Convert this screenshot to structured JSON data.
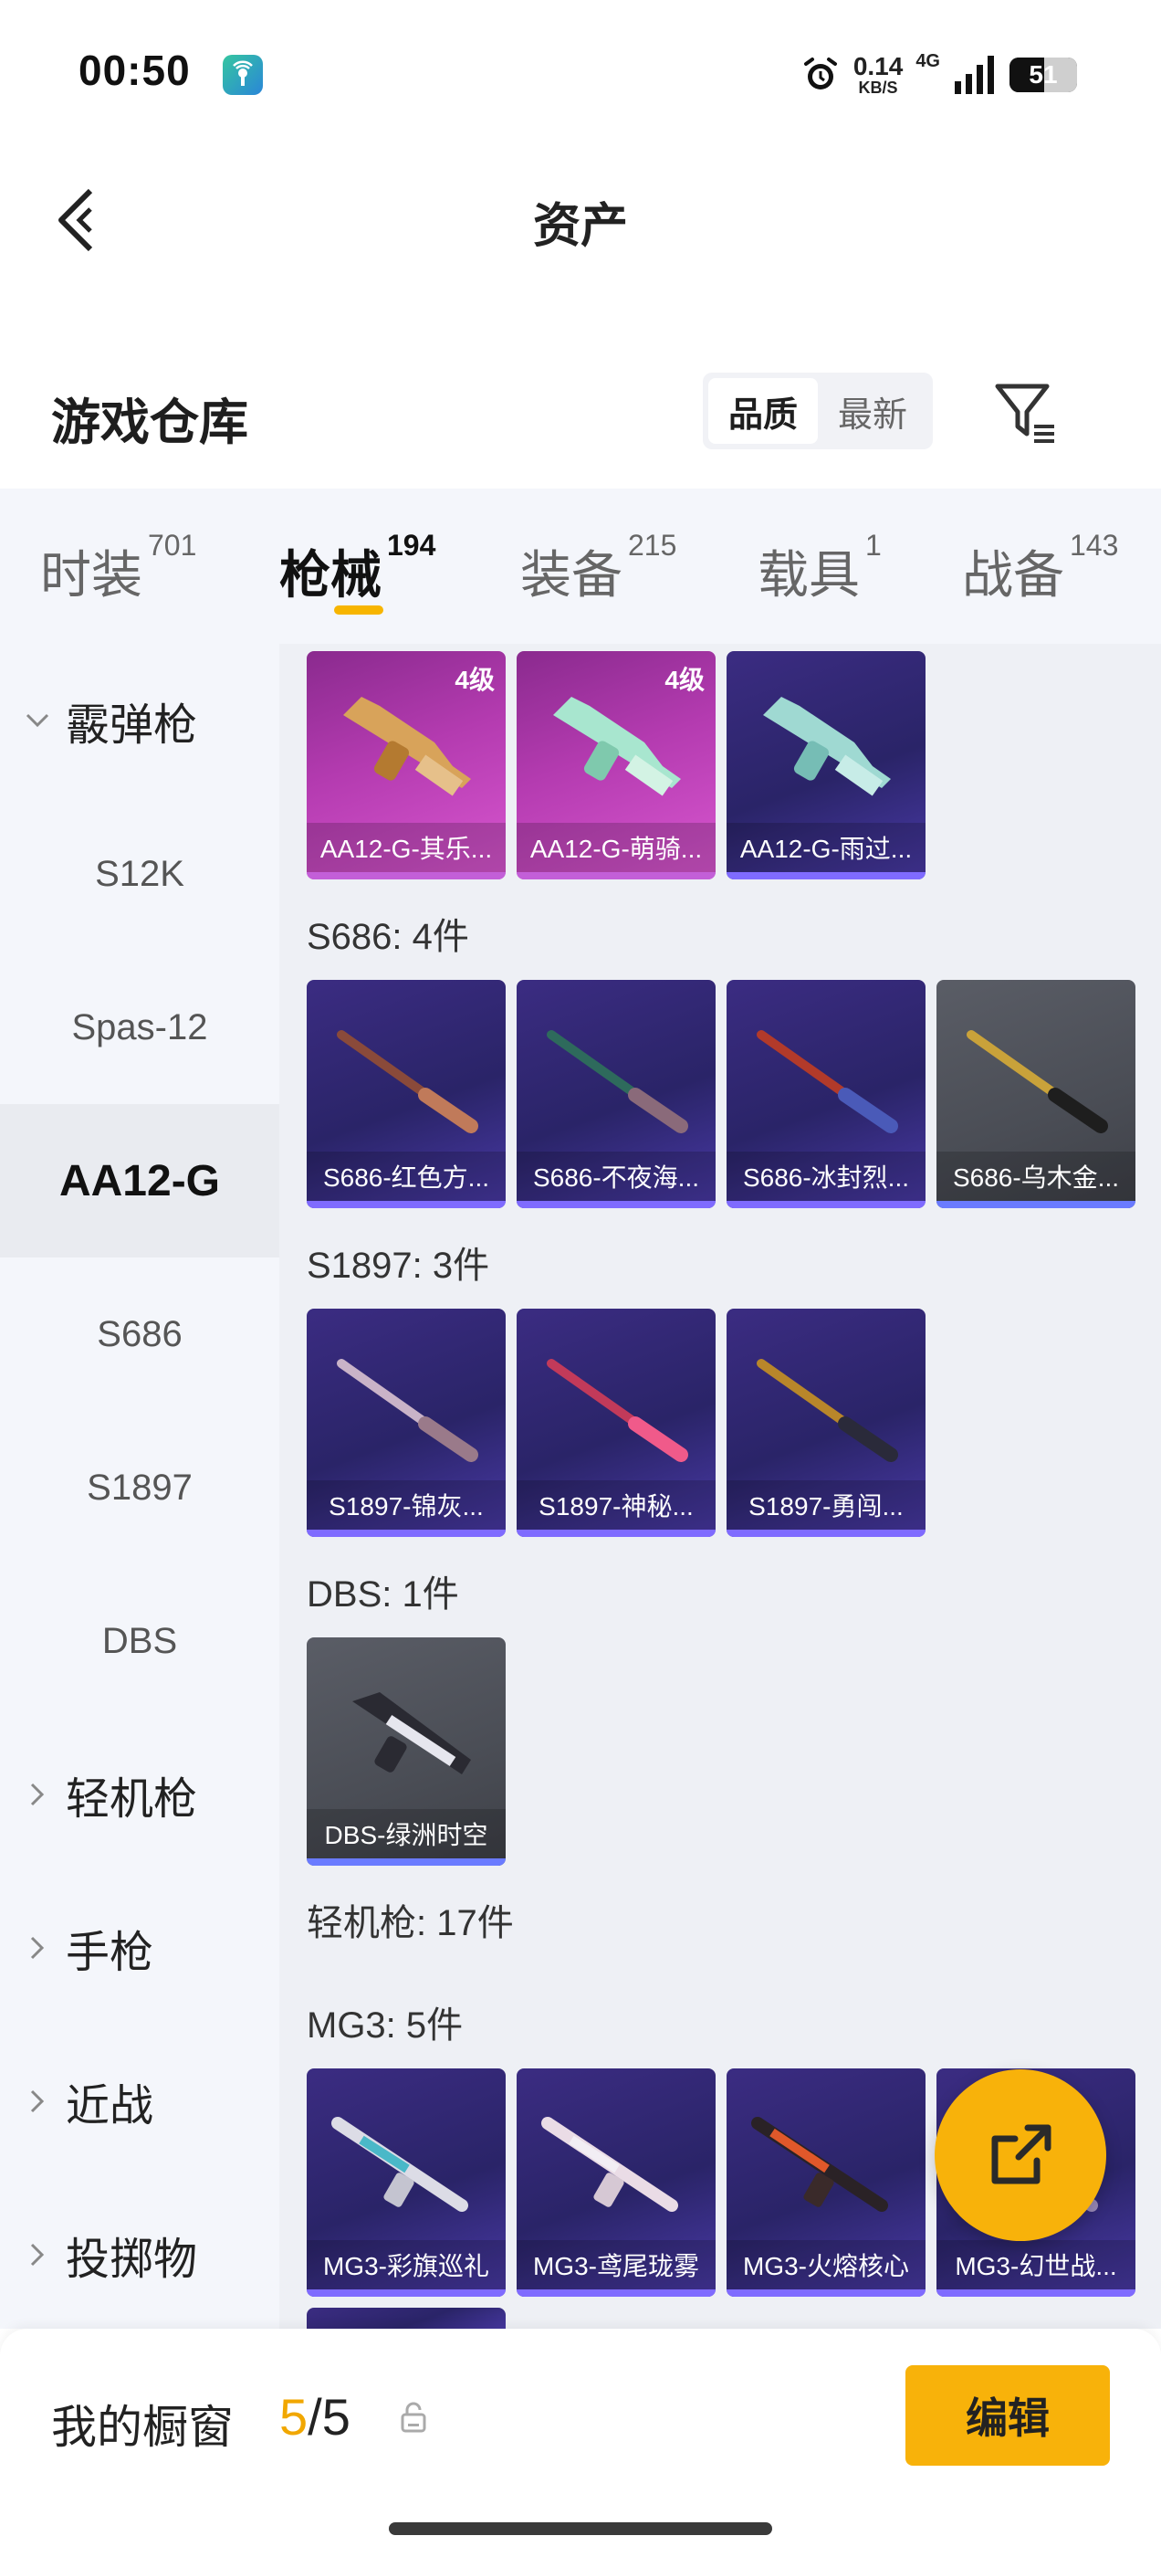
{
  "status_bar": {
    "time": "00:50",
    "net_speed": "0.14",
    "net_unit": "KB/S",
    "net_type": "4G",
    "battery": "51"
  },
  "header": {
    "title": "资产"
  },
  "warehouse": {
    "title": "游戏仓库",
    "sort_options": [
      "品质",
      "最新"
    ],
    "sort_active": "品质"
  },
  "tabs": [
    {
      "label": "时装",
      "count": "701"
    },
    {
      "label": "枪械",
      "count": "194"
    },
    {
      "label": "装备",
      "count": "215"
    },
    {
      "label": "载具",
      "count": "1"
    },
    {
      "label": "战备",
      "count": "143"
    }
  ],
  "sidebar": {
    "items": [
      {
        "label": "霰弹枪",
        "kind": "group-open"
      },
      {
        "label": "S12K"
      },
      {
        "label": "Spas-12"
      },
      {
        "label": "AA12-G",
        "active": true
      },
      {
        "label": "S686"
      },
      {
        "label": "S1897"
      },
      {
        "label": "DBS"
      },
      {
        "label": "轻机枪",
        "kind": "group"
      },
      {
        "label": "手枪",
        "kind": "group"
      },
      {
        "label": "近战",
        "kind": "group"
      },
      {
        "label": "投掷物",
        "kind": "group"
      }
    ]
  },
  "content": {
    "aa12_cards": [
      {
        "name": "AA12-G-其乐...",
        "level": "4级",
        "tier": "pink"
      },
      {
        "name": "AA12-G-萌骑...",
        "level": "4级",
        "tier": "pink"
      },
      {
        "name": "AA12-G-雨过...",
        "tier": "purple"
      }
    ],
    "s686_label": "S686: 4件",
    "s686_cards": [
      {
        "name": "S686-红色方...",
        "tier": "purple"
      },
      {
        "name": "S686-不夜海...",
        "tier": "purple"
      },
      {
        "name": "S686-冰封烈...",
        "tier": "purple"
      },
      {
        "name": "S686-乌木金...",
        "tier": "gray"
      }
    ],
    "s1897_label": "S1897: 3件",
    "s1897_cards": [
      {
        "name": "S1897-锦灰...",
        "tier": "purple"
      },
      {
        "name": "S1897-神秘...",
        "tier": "purple"
      },
      {
        "name": "S1897-勇闯...",
        "tier": "purple"
      }
    ],
    "dbs_label": "DBS: 1件",
    "dbs_cards": [
      {
        "name": "DBS-绿洲时空",
        "tier": "gray"
      }
    ],
    "lmg_label": "轻机枪: 17件",
    "mg3_label": "MG3: 5件",
    "mg3_cards": [
      {
        "name": "MG3-彩旗巡礼",
        "tier": "purple"
      },
      {
        "name": "MG3-鸢尾珑雾",
        "tier": "purple"
      },
      {
        "name": "MG3-火熔核心",
        "tier": "purple"
      },
      {
        "name": "MG3-幻世战...",
        "tier": "purple"
      }
    ]
  },
  "bottom_bar": {
    "showcase_label": "我的橱窗",
    "showcase_current": "5",
    "showcase_sep": "/",
    "showcase_total": "5",
    "edit_label": "编辑"
  },
  "colors": {
    "accent": "#f8b20a",
    "tab_indicator": "#f7b500",
    "card_purple": "#2f2770",
    "card_pink": "#b43bb0",
    "card_gray": "#4c4f57"
  }
}
